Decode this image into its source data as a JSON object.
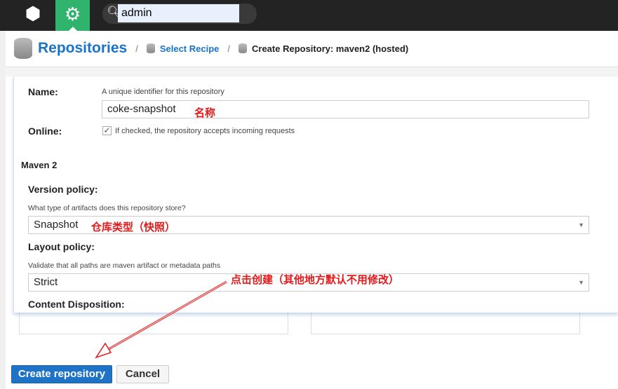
{
  "topbar": {
    "logo_icon": "cube-icon",
    "settings_icon": "gear-icon",
    "search_icon": "search-icon",
    "search_value": "admin"
  },
  "breadcrumb": {
    "root": "Repositories",
    "item1": "Select Recipe",
    "current": "Create Repository: maven2 (hosted)",
    "separator": "/"
  },
  "form": {
    "name_label": "Name:",
    "name_help": "A unique identifier for this repository",
    "name_value": "coke-snapshot",
    "online_label": "Online:",
    "online_checked": true,
    "online_help": "If checked, the repository accepts incoming requests",
    "section": "Maven 2",
    "version_label": "Version policy:",
    "version_help": "What type of artifacts does this repository store?",
    "version_value": "Snapshot",
    "layout_label": "Layout policy:",
    "layout_help": "Validate that all paths are maven artifact or metadata paths",
    "layout_value": "Strict",
    "disposition_label": "Content Disposition:"
  },
  "annotations": {
    "name": "名称",
    "version": "仓库类型（快照）",
    "create": "点击创建（其他地方默认不用修改）",
    "color": "#e5191a"
  },
  "buttons": {
    "create": "Create repository",
    "cancel": "Cancel"
  },
  "colors": {
    "accent": "#1a73c8",
    "settings_active": "#2fb36d",
    "topbar": "#232323"
  }
}
